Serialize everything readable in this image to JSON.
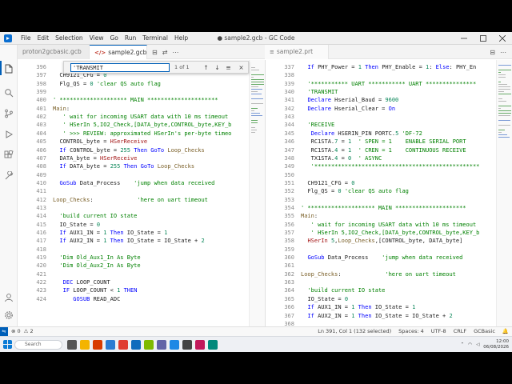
{
  "window": {
    "title": "● sample2.gcb - GC Code",
    "menu": [
      "File",
      "Edit",
      "Selection",
      "View",
      "Go",
      "Run",
      "Terminal",
      "Help"
    ]
  },
  "tabs": [
    {
      "label": "proton2gcbasic.gcb",
      "active": false,
      "dirty": false
    },
    {
      "label": "sample2.gcb 2",
      "active": true,
      "dirty": true
    },
    {
      "label": "sample2.prt",
      "active": false,
      "dirty": false
    }
  ],
  "find": {
    "value": "'TRANSMIT",
    "results": "1 of 1",
    "prev": "↑",
    "next": "↓",
    "more": "≡",
    "close": "×"
  },
  "left_editor": {
    "numbers": [
      "396",
      "397",
      "398",
      "399",
      "400",
      "401",
      "402",
      "403",
      "404",
      "405",
      "406",
      "407",
      "408",
      "409",
      "410",
      "411",
      "412",
      "413",
      "414",
      "415",
      "416",
      "417",
      "418",
      "419",
      "420",
      "421",
      "422",
      "423",
      "424"
    ],
    "lines": [
      "",
      "  CH9121_CFG = 0",
      "  Flg_QS = 0 'clear QS auto flag",
      "",
      "' ******************** MAIN *********************",
      "Main:",
      "   ' wait for incoming USART data with 10 ms timeout",
      "   ' HSerIn 5,IO2_Check,[DATA_byte,CONTROL_byte,KEY_b",
      "   ' >>> REVIEW: approximated HSerIn's per-byte timeo",
      "  CONTROL_byte = HSerReceive",
      "  If CONTROL_byte = 255 Then GoTo Loop_Checks",
      "  DATA_byte = HSerReceive",
      "  If DATA_byte = 255 Then GoTo Loop_Checks",
      "",
      "  GoSub Data_Process    'jump when data received",
      "",
      "Loop_Checks:             'here on uart timeout",
      "",
      "  'build current IO state",
      "  IO_State = 0",
      "  If AUX1_IN = 1 Then IO_State = 1",
      "  If AUX2_IN = 1 Then IO_State = IO_State + 2",
      "",
      "  'Dim Old_Aux1_In As Byte",
      "  'Dim Old_Aux2_In As Byte",
      "",
      "   DEC LOOP_COUNT",
      "   IF LOOP_COUNT < 1 THEN",
      "      GOSUB READ_ADC"
    ]
  },
  "right_editor": {
    "numbers": [
      "337",
      "338",
      "339",
      "340",
      "341",
      "342",
      "343",
      "344",
      "345",
      "346",
      "347",
      "348",
      "349",
      "350",
      "351",
      "352",
      "353",
      "354",
      "355",
      "356",
      "357",
      "358",
      "359",
      "360",
      "361",
      "362",
      "363",
      "364",
      "365",
      "366",
      "367",
      "368"
    ],
    "lines": [
      "  If PHY_Power = 1 Then PHY_Enable = 1: Else: PHY_En",
      "",
      "  '*********** UART *********** UART ***************",
      "  'TRANSMIT",
      "  Declare Hserial_Baud = 9600",
      "  Declare Hserial_Clear = On",
      "",
      "  'RECEIVE",
      "   Declare HSERIN_PIN PORTC.5 'DF-72",
      "   RC1STA.7 = 1  ' SPEN = 1    ENABLE SERIAL PORT",
      "   RC1STA.4 = 1  ' CREN = 1    CONTINUOUS RECEIVE",
      "   TX1STA.4 = 0  ' ASYNC",
      "   '*************************************************",
      "",
      "  CH9121_CFG = 0",
      "  Flg_QS = 0 'clear QS auto flag",
      "",
      "' ******************** MAIN *********************",
      "Main:",
      "   ' wait for incoming USART data with 10 ms timeout",
      "   ' HSerIn 5,IO2_Check,[DATA_byte,CONTROL_byte,KEY_b",
      "  HSerIn 5,Loop_Checks,[CONTROL_byte, DATA_byte]",
      "",
      "  GoSub Data_Process    'jump when data received",
      "",
      "Loop_Checks:             'here on uart timeout",
      "",
      "  'build current IO state",
      "  IO_State = 0",
      "  If AUX1_IN = 1 Then IO_State = 1",
      "  If AUX2_IN = 1 Then IO_State = IO_State + 2",
      ""
    ]
  },
  "status": {
    "remote": "⇋",
    "errors": "⊗ 0",
    "warnings": "⚠ 2",
    "position": "Ln 391, Col 1 (132 selected)",
    "spaces": "Spaces: 4",
    "encoding": "UTF-8",
    "eol": "CRLF",
    "language": "GCBasic",
    "bell": "🔔"
  },
  "taskbar": {
    "search_placeholder": "Search",
    "time": "12:00",
    "date": "06/08/2026"
  },
  "colors": {
    "accent": "#005fb8",
    "keyword": "#0000ff",
    "comment": "#008000",
    "number": "#098658",
    "label": "#795e26",
    "hserin": "#a31515"
  }
}
